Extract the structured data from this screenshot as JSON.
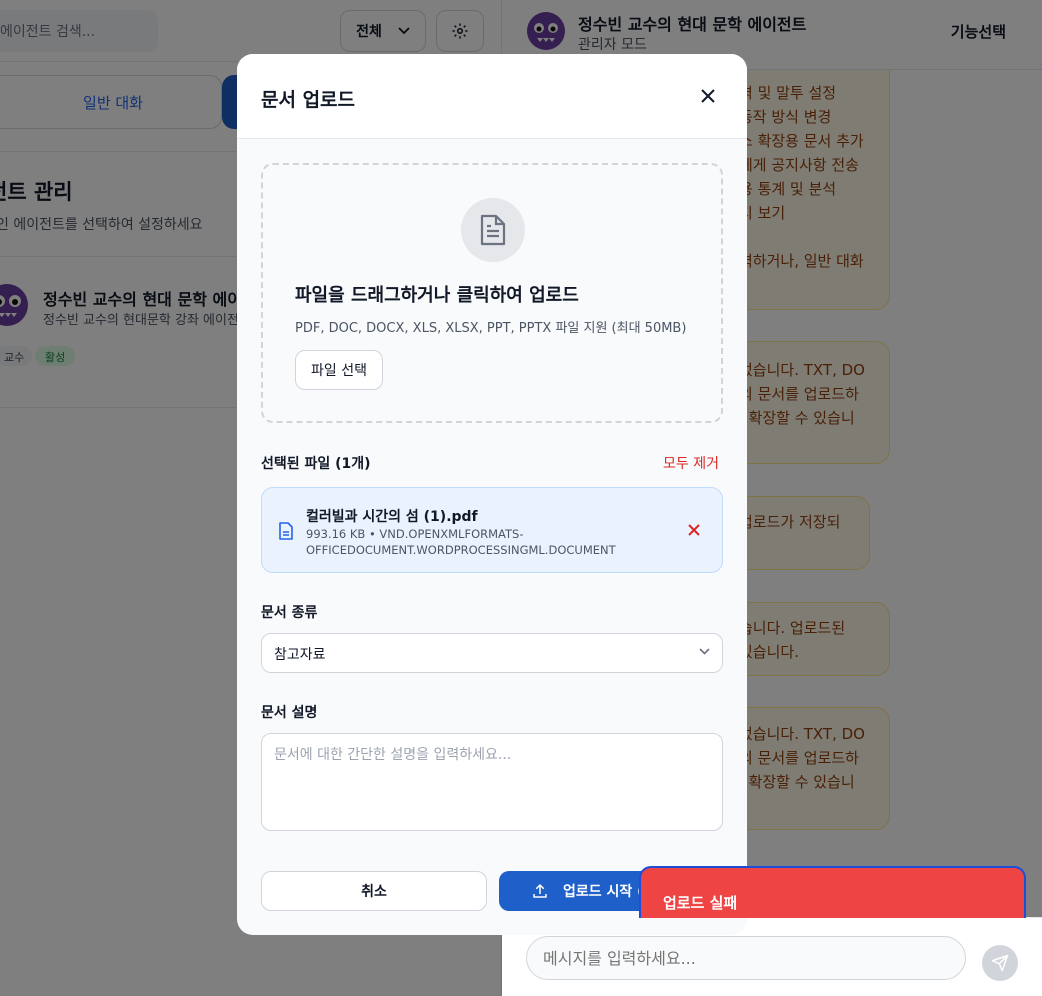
{
  "left_panel": {
    "search_placeholder": "에이전트 검색...",
    "filter_label": "전체",
    "tab_chat_label": "일반 대화",
    "section_title": "전트 관리",
    "section_subtitle": "인 에이전트를 선택하여 설정하세요",
    "agent": {
      "name": "정수빈 교수의 현대 문학 에이전",
      "description": "정수빈 교수의 현대문학 강좌 에이전",
      "tag_role": "교수",
      "tag_status": "활성"
    }
  },
  "right_panel": {
    "title": "정수빈 교수의 현대 문학 에이전트",
    "mode": "관리자 모드",
    "function_button": "기능선택",
    "bubble1_lines": [
      "격 및 말투 설정",
      "동작 방식 변경",
      "소 확장용 문서 추가",
      "에게 공지사항 전송",
      "용 통계 및 분석",
      "시 보기",
      "",
      "력하거나, 일반 대화"
    ],
    "bubble2_lines": [
      "었습니다. TXT, DO",
      "의 문서를 업로드하",
      "· 확장할 수 있습니"
    ],
    "bubble3_lines": [
      "업로드가 저장되"
    ],
    "bubble4_lines": [
      "습니다. 업로드된",
      "있습니다."
    ],
    "bubble5_lines": [
      "었습니다. TXT, DO",
      "의 문서를 업로드하",
      "· 확장할 수 있습니"
    ],
    "message_placeholder": "메시지를 입력하세요..."
  },
  "modal": {
    "title": "문서 업로드",
    "dropzone_title": "파일을 드래그하거나 클릭하여 업로드",
    "dropzone_subtitle": "PDF, DOC, DOCX, XLS, XLSX, PPT, PPTX 파일 지원 (최대 50MB)",
    "pick_button": "파일 선택",
    "selected_label": "선택된 파일 (1개)",
    "remove_all": "모두 제거",
    "file": {
      "name": "컬러빌과 시간의 섬 (1).pdf",
      "meta": "993.16 KB • VND.OPENXMLFORMATS-OFFICEDOCUMENT.WORDPROCESSINGML.DOCUMENT"
    },
    "doc_type_label": "문서 종류",
    "doc_type_value": "참고자료",
    "description_label": "문서 설명",
    "description_placeholder": "문서에 대한 간단한 설명을 입력하세요...",
    "cancel_button": "취소",
    "upload_button": "업로드 시작 ("
  },
  "toast": {
    "message": "업로드 실패",
    "color": "#ef4444"
  },
  "colors": {
    "primary": "#1e5fc9",
    "danger": "#dc2626",
    "bubble_bg": "#fef9e7",
    "bubble_text": "#92400e"
  }
}
